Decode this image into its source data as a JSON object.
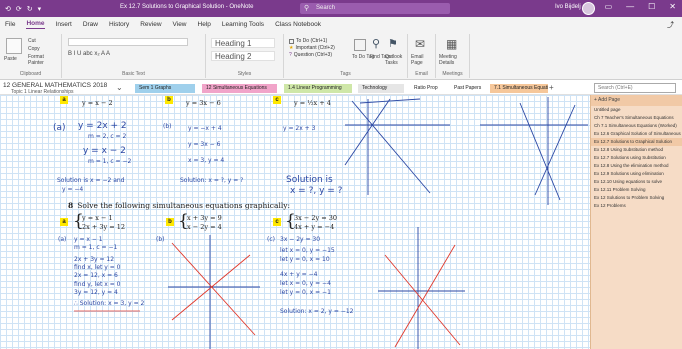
{
  "window": {
    "title": "Ex 12.7 Solutions to Graphical Solution - OneNote",
    "search_placeholder": "Search",
    "user": "Ivo Bijdelj",
    "quick_access": [
      "⟲",
      "⟳",
      "↻",
      "▾"
    ],
    "controls": [
      "▭",
      "—",
      "☐",
      "✕"
    ]
  },
  "menu": {
    "tabs": [
      "File",
      "Home",
      "Insert",
      "Draw",
      "History",
      "Review",
      "View",
      "Help",
      "Learning Tools",
      "Class Notebook"
    ],
    "active": "Home"
  },
  "ribbon": {
    "clipboard": {
      "paste": "Paste",
      "cut": "Cut",
      "copy": "Copy",
      "format_painter": "Format Painter",
      "label": "Clipboard"
    },
    "basic_text": {
      "font": "B  I  U  abc  x₂  A  A",
      "label": "Basic Text"
    },
    "styles": {
      "heading1": "Heading 1",
      "heading2": "Heading 2",
      "label": "Styles"
    },
    "tags": {
      "items": [
        "To Do (Ctrl+1)",
        "Important (Ctrl+2)",
        "Question (Ctrl+3)"
      ],
      "todo_tag": "To Do Tag",
      "find_tags": "Find Tags",
      "outlook_tasks": "Outlook Tasks",
      "label": "Tags"
    },
    "email": {
      "button": "Email Page",
      "label": "Email"
    },
    "meetings": {
      "button": "Meeting Details",
      "label": "Meetings"
    }
  },
  "notebook": {
    "name": "12 GENERAL MATHEMATICS 2018",
    "section": "Topic 1 Linear Relationships",
    "sections": [
      {
        "label": "Sem 1 Graphs",
        "color": "#9fd0ec"
      },
      {
        "label": "12 Simultaneous Equations",
        "color": "#f1a4c9"
      },
      {
        "label": "1.4 Linear Programming",
        "color": "#cfe7a8"
      },
      {
        "label": "Technology",
        "color": "#e6e6e6"
      },
      {
        "label": "Ratio Prop",
        "color": "#ffffff"
      },
      {
        "label": "Past Papers",
        "color": "#ffffff"
      },
      {
        "label": "7.1 Simultaneous Equations",
        "color": "#f6c79a"
      }
    ],
    "search_placeholder": "Search (Ctrl+E)"
  },
  "page": {
    "q7": {
      "a_label": "a",
      "a_eq2": "y = x − 2",
      "b_label": "b",
      "b_eq2": "y = 3x − 6",
      "c_label": "c",
      "c_eq2": "y = ½x + 4"
    },
    "q7_work": {
      "a_head": "(a)",
      "a_line1": "y = 2x + 2",
      "a_line2": "m = 2,  c = 2",
      "a_line3": "y = x − 2",
      "a_line4": "m = 1,  c = −2",
      "a_line5": "Solution is  x = −2 and",
      "a_line6": "y = −4",
      "a_line7": "Solution:  x = ?,  y = ?",
      "b_head": "(b)",
      "b_line1": "y = −x + 4",
      "b_line2": "y = 3x − 6",
      "b_line3": "x = 3,  y = 4",
      "c_line1": "y = 2x + 3",
      "c_line2": "Solution is",
      "c_line3": "x = ?,  y = ?"
    },
    "q8": {
      "number": "8",
      "prompt": "Solve the following simultaneous equations graphically:",
      "a_label": "a",
      "a_eq1": "y = x − 1",
      "a_eq2": "2x + 3y = 12",
      "b_label": "b",
      "b_eq1": "x + 3y = 9",
      "b_eq2": "x − 2y = 4",
      "c_label": "c",
      "c_eq1": "3x − 2y = 30",
      "c_eq2": "4x + y = −4"
    },
    "q8_work": {
      "a_head": "(a)",
      "a_lines": [
        "y = x − 1",
        "m = 1,  c = −1",
        "2x + 3y = 12",
        "find x,  let y = 0",
        "2x = 12,  x = 6",
        "find y,  let x = 0",
        "3y = 12,  y = 4",
        "∴ Solution: x = 3,  y = 2"
      ],
      "b_head": "(b)",
      "c_head": "(c)",
      "c_lines": [
        "3x − 2y = 30",
        "let x = 0,  y = −15",
        "let y = 0,  x = 10",
        "4x + y = −4",
        "let x = 0,  y = −4",
        "let y = 0,  x = −1",
        "Solution: x = 2,  y = −12"
      ]
    }
  },
  "pages": {
    "add_page": "+ Add Page",
    "items": [
      "Untitled page",
      "Ch 7 Teacher's Simultaneous Equations",
      "Ch 7.1 Simultaneous Equations (Worked)",
      "Ex 12.6 Graphical Solution of Simultaneous",
      "Ex 12.7 Solutions to Graphical Solution",
      "Ex 12.8 Using Substitution method",
      "Ex 12.7 Solutions using Substitution",
      "Ex 12.8 Using the elimination method",
      "Ex 12.9 Solutions using elimination",
      "Ex 12.10 Using equations to solve",
      "Ex 12.11 Problem Solving",
      "Ex 12 Solutions to Problem Solving",
      "Ex 12 Problems"
    ],
    "active_index": 4
  },
  "colors": {
    "accent": "#7a3a8c",
    "ink_blue": "#2b47a3",
    "ink_red": "#e0382b",
    "highlight": "#ffe800"
  }
}
